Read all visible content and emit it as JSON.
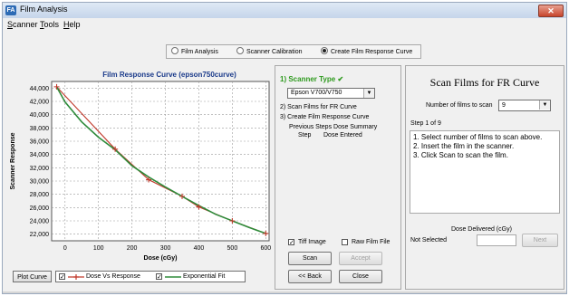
{
  "window": {
    "title": "Film Analysis",
    "app_icon_label": "FA",
    "close_glyph": "✕"
  },
  "menu": [
    "Scanner",
    "Tools",
    "Help"
  ],
  "modes": [
    {
      "label": "Film Analysis",
      "selected": false
    },
    {
      "label": "Scanner Calibration",
      "selected": false
    },
    {
      "label": "Create Film Response Curve",
      "selected": true
    }
  ],
  "chart_data": {
    "type": "line",
    "title": "Film Response Curve (epson750curve)",
    "xlabel": "Dose (cGy)",
    "ylabel": "Scanner Response",
    "xlim": [
      -40,
      610
    ],
    "ylim": [
      21000,
      45000
    ],
    "x_ticks": [
      "0",
      "100",
      "200",
      "300",
      "400",
      "500",
      "600"
    ],
    "y_ticks": [
      "22,000",
      "24,000",
      "26,000",
      "28,000",
      "30,000",
      "32,000",
      "34,000",
      "36,000",
      "38,000",
      "40,000",
      "42,000",
      "44,000"
    ],
    "grid": true,
    "series": [
      {
        "name": "Dose Vs Response",
        "color": "#c0392b",
        "marker": "+",
        "x": [
          -25,
          150,
          250,
          350,
          400,
          500,
          600
        ],
        "y": [
          44200,
          34800,
          30200,
          27700,
          26100,
          24000,
          22100
        ]
      },
      {
        "name": "Exponential Fit",
        "color": "#2e8b3a",
        "x": [
          -25,
          0,
          50,
          100,
          150,
          200,
          250,
          300,
          350,
          400,
          450,
          500,
          550,
          600
        ],
        "y": [
          44200,
          41900,
          38900,
          36600,
          34700,
          32300,
          30600,
          29100,
          27700,
          26300,
          25000,
          24000,
          23000,
          22100
        ]
      }
    ]
  },
  "legend": {
    "plot_curve_label": "Plot Curve",
    "check1": "✓",
    "check2": "✓",
    "dose_vs_response": "Dose Vs Response",
    "exponential_fit": "Exponential Fit"
  },
  "steps": {
    "step1_label": "1)  Scanner Type",
    "step1_check": "✔",
    "scanner_value": "Epson V700/V750",
    "step2_label": "2)  Scan Films for FR Curve",
    "step3_label": "3)  Create Film Response Curve",
    "prev_summary": "Previous Steps Dose Summary",
    "col_step": "Step",
    "col_dose": "Dose Entered"
  },
  "options": {
    "tiff_image": "Tiff Image",
    "tiff_checked": true,
    "raw_film": "Raw Film File",
    "raw_checked": false
  },
  "buttons": {
    "scan": "Scan",
    "accept": "Accept",
    "back": "<< Back",
    "close": "Close",
    "next": "Next"
  },
  "right": {
    "title": "Scan Films for FR Curve",
    "films_label": "Number of films to scan",
    "films_value": "9",
    "step_counter": "Step 1 of 9",
    "instructions": [
      "1.  Select number of films to scan above.",
      "2.  Insert the film in the scanner.",
      "3.  Click Scan to scan the film."
    ],
    "dose_label": "Dose Delivered (cGy)",
    "not_selected": "Not Selected"
  },
  "icons": {
    "dropdown": "▼"
  }
}
